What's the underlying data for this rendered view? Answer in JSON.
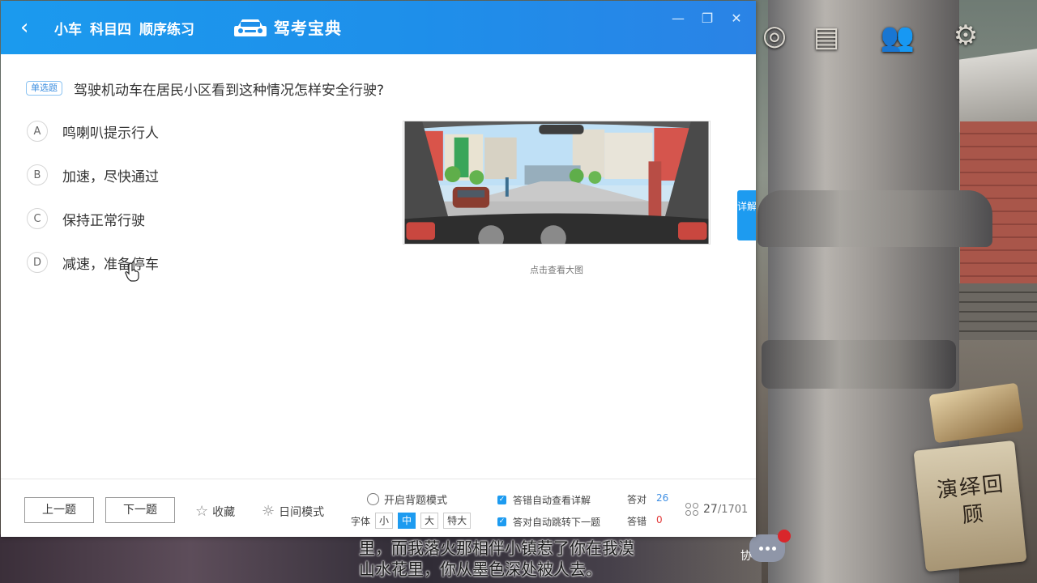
{
  "colors": {
    "accent": "#1d9bf0",
    "titlebar": "#1e8fea",
    "correct": "#3f8fe3",
    "wrong": "#e23a3a"
  },
  "titlebar": {
    "back_icon": "chevron-left-icon",
    "breadcrumb": [
      "小车",
      "科目四",
      "顺序练习"
    ],
    "brand_name": "驾考宝典",
    "controls": [
      "minimize-icon",
      "restore-icon",
      "close-icon"
    ]
  },
  "question": {
    "type_badge": "单选题",
    "text": "驾驶机动车在居民小区看到这种情况怎样安全行驶?",
    "options": [
      {
        "letter": "A",
        "text": "鸣喇叭提示行人"
      },
      {
        "letter": "B",
        "text": "加速，尽快通过"
      },
      {
        "letter": "C",
        "text": "保持正常行驶"
      },
      {
        "letter": "D",
        "text": "减速，准备停车"
      }
    ],
    "image_hint": "点击查看大图",
    "detail_tab": "详解"
  },
  "footer": {
    "prev": "上一题",
    "next": "下一题",
    "favorite": "收藏",
    "day_mode": "日间模式",
    "memorize_mode": "开启背题模式",
    "font_label": "字体",
    "font_sizes": [
      "小",
      "中",
      "大",
      "特大"
    ],
    "font_selected": "中",
    "auto_detail": "答错自动查看详解",
    "auto_next": "答对自动跳转下一题",
    "correct_label": "答对",
    "correct_count": "26",
    "wrong_label": "答错",
    "wrong_count": "0",
    "progress_current": "27",
    "progress_total": "/1701"
  },
  "overlay": {
    "subtitle_line1": "里，而我落火那相伴小镇惹了你在我漠",
    "subtitle_line2": "山水花里，你从墨色深处被人去。",
    "chat_label": "协",
    "scroll_text": "演绎回顾"
  }
}
